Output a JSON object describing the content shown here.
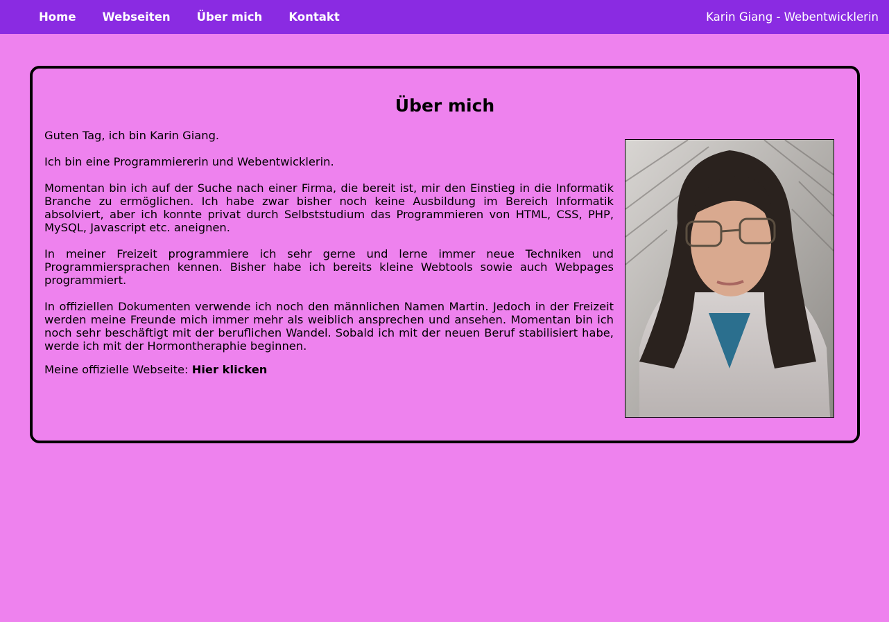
{
  "nav": {
    "items": [
      {
        "label": "Home"
      },
      {
        "label": "Webseiten"
      },
      {
        "label": "Über mich"
      },
      {
        "label": "Kontakt"
      }
    ],
    "brand": "Karin Giang - Webentwicklerin"
  },
  "page": {
    "title": "Über mich",
    "paragraphs": [
      "Guten Tag, ich bin Karin Giang.",
      "Ich bin eine Programmiererin und Webentwicklerin.",
      "Momentan bin ich auf der Suche nach einer Firma, die bereit ist, mir den Einstieg in die Informatik Branche zu ermöglichen. Ich habe zwar bisher noch keine Ausbildung im Bereich Informatik absolviert, aber ich konnte privat durch Selbststudium das Programmieren von HTML, CSS, PHP, MySQL, Javascript etc. aneignen.",
      "In meiner Freizeit programmiere ich sehr gerne und lerne immer neue Techniken und Programmiersprachen kennen. Bisher habe ich bereits kleine Webtools sowie auch Webpages programmiert.",
      "In offiziellen Dokumenten verwende ich noch den männlichen Namen Martin. Jedoch in der Freizeit werden meine Freunde mich immer mehr als weiblich ansprechen und ansehen. Momentan bin ich noch sehr beschäftigt mit der beruflichen Wandel. Sobald ich mit der neuen Beruf stabilisiert habe, werde ich mit der Hormontheraphie beginnen."
    ],
    "website_label": "Meine offizielle Webseite: ",
    "website_link": "Hier klicken"
  },
  "colors": {
    "background": "#ee82ee",
    "navbar": "#8a2be2",
    "nav_text": "#ffffff"
  }
}
